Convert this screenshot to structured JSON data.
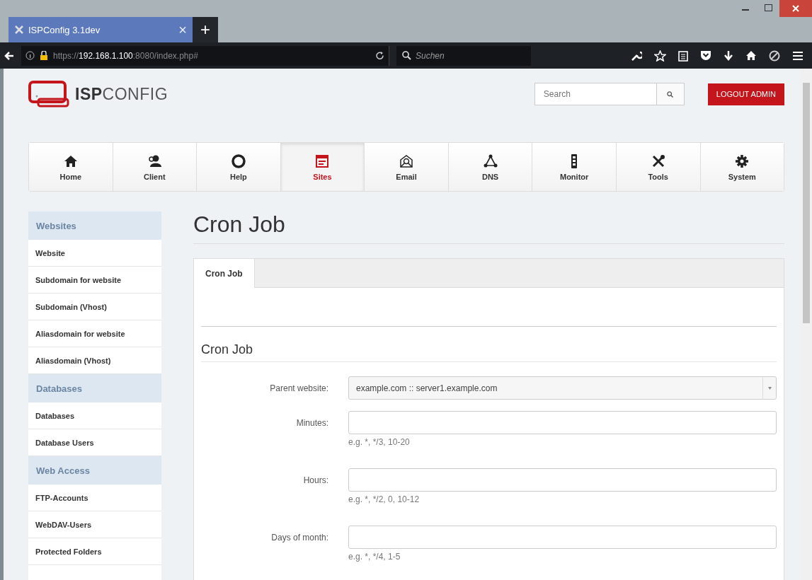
{
  "browser": {
    "tab_title": "ISPConfig 3.1dev",
    "tab_close": "×",
    "new_tab": "+",
    "url": "https://**192.168.1.100**:8080/index.php#",
    "search_placeholder": "Suchen"
  },
  "header": {
    "logo": "**ISP**CONFIG",
    "search_placeholder": "Search",
    "logout": "LOGOUT ADMIN"
  },
  "nav": [
    {
      "label": "Home",
      "selected": false
    },
    {
      "label": "Client",
      "selected": false
    },
    {
      "label": "Help",
      "selected": false
    },
    {
      "label": "Sites",
      "selected": true
    },
    {
      "label": "Email",
      "selected": false
    },
    {
      "label": "DNS",
      "selected": false
    },
    {
      "label": "Monitor",
      "selected": false
    },
    {
      "label": "Tools",
      "selected": false
    },
    {
      "label": "System",
      "selected": false
    }
  ],
  "sidebar": [
    {
      "title": "Websites",
      "items": [
        "Website",
        "Subdomain for website",
        "Subdomain (Vhost)",
        "Aliasdomain for website",
        "Aliasdomain (Vhost)"
      ]
    },
    {
      "title": "Databases",
      "items": [
        "Databases",
        "Database Users"
      ]
    },
    {
      "title": "Web Access",
      "items": [
        "FTP-Accounts",
        "WebDAV-Users",
        "Protected Folders"
      ]
    }
  ],
  "content": {
    "title": "Cron Job",
    "tabs": [
      {
        "label": "Cron Job",
        "selected": true
      }
    ],
    "section_title": "Cron Job",
    "fields": [
      {
        "kind": "select",
        "label": "Parent website:",
        "value": "example.com :: server1.example.com"
      },
      {
        "kind": "text",
        "label": "Minutes:",
        "hint": "e.g. *, */3, 10-20"
      },
      {
        "kind": "text",
        "label": "Hours:",
        "hint": "e.g. *, */2, 0, 10-12"
      },
      {
        "kind": "text",
        "label": "Days of month:",
        "hint": "e.g. *, */4, 1-5"
      }
    ]
  }
}
